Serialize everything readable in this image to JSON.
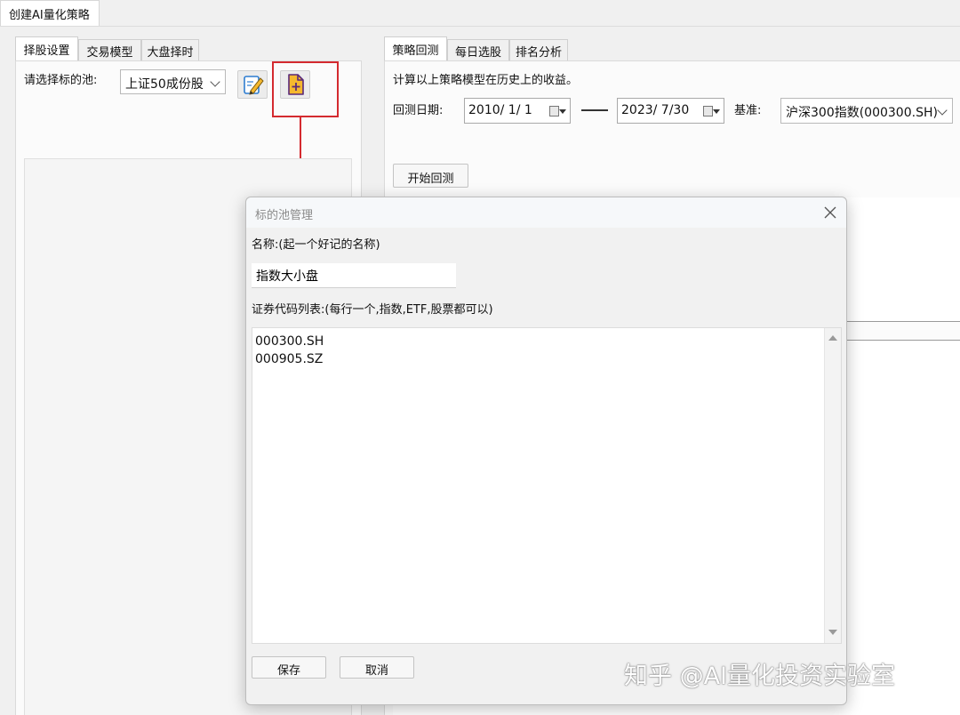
{
  "window": {
    "tab_title": "创建AI量化策略"
  },
  "left_panel": {
    "tabs": [
      "择股设置",
      "交易模型",
      "大盘择时"
    ],
    "pool_label": "请选择标的池:",
    "pool_selected": "上证50成份股"
  },
  "right_panel": {
    "tabs": [
      "策略回测",
      "每日选股",
      "排名分析"
    ],
    "description": "计算以上策略模型在历史上的收益。",
    "date_label": "回测日期:",
    "start_date": "2010/ 1/ 1",
    "end_date": "2023/ 7/30",
    "benchmark_label": "基准:",
    "benchmark_selected": "沪深300指数(000300.SH)",
    "start_button": "开始回测"
  },
  "dialog": {
    "title": "标的池管理",
    "name_label": "名称:(起一个好记的名称)",
    "name_value": "指数大小盘",
    "codes_label": "证券代码列表:(每行一个,指数,ETF,股票都可以)",
    "codes": [
      "000300.SH",
      "000905.SZ"
    ],
    "save_button": "保存",
    "cancel_button": "取消"
  },
  "watermark": "知乎 @AI量化投资实验室",
  "colors": {
    "highlight": "#d42a2f",
    "accent": "#c0392b"
  }
}
